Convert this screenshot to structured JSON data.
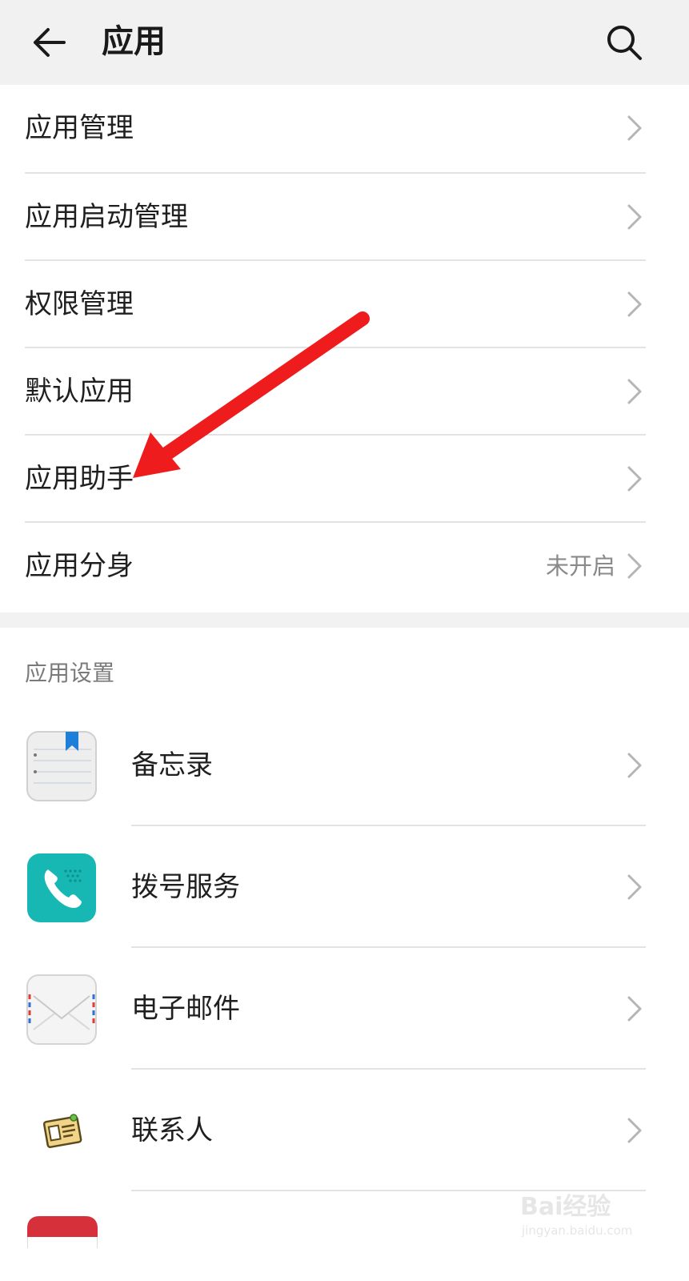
{
  "header": {
    "title": "应用",
    "back_icon": "arrow-left-icon",
    "search_icon": "search-icon"
  },
  "menu": [
    {
      "label": "应用管理",
      "value": ""
    },
    {
      "label": "应用启动管理",
      "value": ""
    },
    {
      "label": "权限管理",
      "value": ""
    },
    {
      "label": "默认应用",
      "value": ""
    },
    {
      "label": "应用助手",
      "value": ""
    },
    {
      "label": "应用分身",
      "value": "未开启"
    }
  ],
  "app_settings": {
    "title": "应用设置",
    "apps": [
      {
        "label": "备忘录",
        "icon": "notes-app-icon"
      },
      {
        "label": "拨号服务",
        "icon": "phone-app-icon"
      },
      {
        "label": "电子邮件",
        "icon": "email-app-icon"
      },
      {
        "label": "联系人",
        "icon": "contacts-app-icon"
      }
    ]
  },
  "annotation": {
    "arrow_color": "#ee1c1c"
  },
  "watermark": {
    "text": "Bai经验",
    "sub": "jingyan.baidu.com"
  }
}
